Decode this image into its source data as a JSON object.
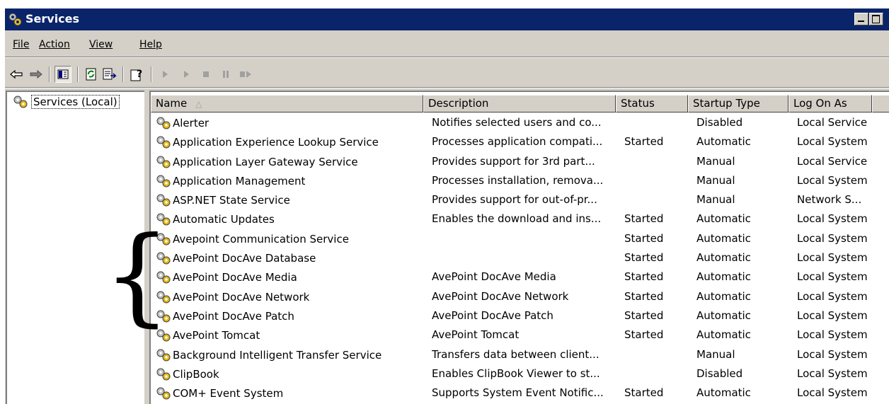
{
  "window": {
    "title": "Services"
  },
  "menu": [
    {
      "label": "File",
      "accel_index": 0
    },
    {
      "label": "Action",
      "accel_index": 0
    },
    {
      "label": "View",
      "accel_index": 0
    },
    {
      "label": "Help",
      "accel_index": 0
    }
  ],
  "tree": {
    "root_label": "Services (Local)"
  },
  "columns": {
    "name": "Name",
    "description": "Description",
    "status": "Status",
    "startup": "Startup Type",
    "logon": "Log On As"
  },
  "rows": [
    {
      "name": "Alerter",
      "description": "Notifies selected users and co...",
      "status": "",
      "startup": "Disabled",
      "logon": "Local Service"
    },
    {
      "name": "Application Experience Lookup Service",
      "description": "Processes application compati...",
      "status": "Started",
      "startup": "Automatic",
      "logon": "Local System"
    },
    {
      "name": "Application Layer Gateway Service",
      "description": "Provides support for 3rd part...",
      "status": "",
      "startup": "Manual",
      "logon": "Local Service"
    },
    {
      "name": "Application Management",
      "description": "Processes installation, remova...",
      "status": "",
      "startup": "Manual",
      "logon": "Local System"
    },
    {
      "name": "ASP.NET State Service",
      "description": "Provides support for out-of-pr...",
      "status": "",
      "startup": "Manual",
      "logon": "Network S..."
    },
    {
      "name": "Automatic Updates",
      "description": "Enables the download and ins...",
      "status": "Started",
      "startup": "Automatic",
      "logon": "Local System"
    },
    {
      "name": "Avepoint Communication Service",
      "description": "",
      "status": "Started",
      "startup": "Automatic",
      "logon": "Local System"
    },
    {
      "name": "AvePoint DocAve Database",
      "description": "",
      "status": "Started",
      "startup": "Automatic",
      "logon": "Local System"
    },
    {
      "name": "AvePoint DocAve Media",
      "description": "AvePoint DocAve Media",
      "status": "Started",
      "startup": "Automatic",
      "logon": "Local System"
    },
    {
      "name": "AvePoint DocAve Network",
      "description": "AvePoint DocAve Network",
      "status": "Started",
      "startup": "Automatic",
      "logon": "Local System"
    },
    {
      "name": "AvePoint DocAve Patch",
      "description": "AvePoint DocAve Patch",
      "status": "Started",
      "startup": "Automatic",
      "logon": "Local System"
    },
    {
      "name": "AvePoint Tomcat",
      "description": "AvePoint Tomcat",
      "status": "Started",
      "startup": "Automatic",
      "logon": "Local System"
    },
    {
      "name": "Background Intelligent Transfer Service",
      "description": "Transfers data between client...",
      "status": "",
      "startup": "Manual",
      "logon": "Local System"
    },
    {
      "name": "ClipBook",
      "description": "Enables ClipBook Viewer to st...",
      "status": "",
      "startup": "Disabled",
      "logon": "Local System"
    },
    {
      "name": "COM+ Event System",
      "description": "Supports System Event Notific...",
      "status": "Started",
      "startup": "Automatic",
      "logon": "Local System"
    }
  ],
  "annotation": {
    "brace": "{"
  },
  "colors": {
    "titlebar": "#0a246a",
    "face": "#d4d0c8",
    "shadow": "#808080",
    "window_bg": "#ffffff"
  }
}
